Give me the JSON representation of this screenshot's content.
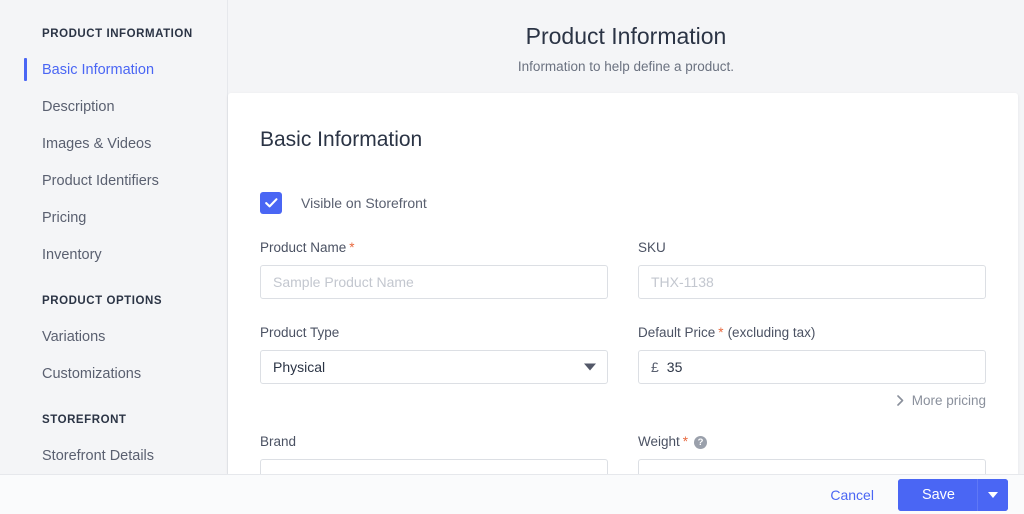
{
  "sidebar": {
    "sections": [
      {
        "title": "PRODUCT INFORMATION",
        "items": [
          {
            "label": "Basic Information",
            "active": true
          },
          {
            "label": "Description",
            "active": false
          },
          {
            "label": "Images & Videos",
            "active": false
          },
          {
            "label": "Product Identifiers",
            "active": false
          },
          {
            "label": "Pricing",
            "active": false
          },
          {
            "label": "Inventory",
            "active": false
          }
        ]
      },
      {
        "title": "PRODUCT OPTIONS",
        "items": [
          {
            "label": "Variations",
            "active": false
          },
          {
            "label": "Customizations",
            "active": false
          }
        ]
      },
      {
        "title": "STOREFRONT",
        "items": [
          {
            "label": "Storefront Details",
            "active": false
          }
        ]
      }
    ]
  },
  "header": {
    "title": "Product Information",
    "subtitle": "Information to help define a product."
  },
  "card": {
    "title": "Basic Information",
    "visibility": {
      "label": "Visible on Storefront",
      "checked": true,
      "icon": "check-icon"
    },
    "fields": {
      "product_name": {
        "label": "Product Name",
        "required_marker": "*",
        "value": "",
        "placeholder": "Sample Product Name"
      },
      "sku": {
        "label": "SKU",
        "value": "",
        "placeholder": "THX-1138"
      },
      "product_type": {
        "label": "Product Type",
        "value": "Physical",
        "caret_icon": "caret-down-icon"
      },
      "default_price": {
        "label": "Default Price",
        "required_marker": "*",
        "label_suffix": "(excluding tax)",
        "currency_symbol": "£",
        "value": "35"
      },
      "brand": {
        "label": "Brand",
        "value": ""
      },
      "weight": {
        "label": "Weight",
        "required_marker": "*",
        "help_icon": "help-circle-icon",
        "help_glyph": "?",
        "value": ""
      }
    },
    "more_pricing": {
      "label": "More pricing",
      "icon": "chevron-right-icon"
    }
  },
  "footer": {
    "cancel_label": "Cancel",
    "save_label": "Save",
    "save_caret_icon": "caret-down-icon"
  },
  "colors": {
    "accent": "#4a66f4",
    "required": "#e8693f",
    "page_bg": "#f4f5f7",
    "card_bg": "#ffffff",
    "text_dark": "#2b3445",
    "text_muted": "#5a6070",
    "placeholder": "#c3c7cf"
  }
}
